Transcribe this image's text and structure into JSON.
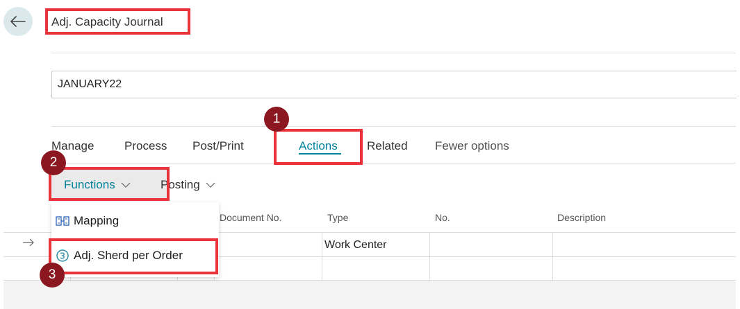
{
  "header": {
    "title": "Adj. Capacity Journal"
  },
  "batch": {
    "value": "JANUARY22"
  },
  "action_bar": {
    "tabs": [
      "Manage",
      "Process",
      "Post/Print",
      "Actions",
      "Related",
      "Fewer options"
    ],
    "active_tab": "Actions"
  },
  "sub_bar": {
    "functions_label": "Functions",
    "posting_label": "Posting"
  },
  "functions_menu": {
    "items": [
      {
        "label": "Mapping",
        "icon": "mapping-icon"
      },
      {
        "label": "Adj. Sherd per Order",
        "icon": "adjust-icon"
      }
    ]
  },
  "grid": {
    "columns": [
      "Document No.",
      "Type",
      "No.",
      "Description"
    ],
    "rows": [
      {
        "document_no": "",
        "type": "Work Center",
        "no": "",
        "description": ""
      }
    ]
  },
  "callouts": [
    "1",
    "2",
    "3"
  ],
  "colors": {
    "accent": "#00829b",
    "callout_border": "#e8343a",
    "badge_fill": "#8b1820",
    "back_button_bg": "#dbe9ec"
  }
}
